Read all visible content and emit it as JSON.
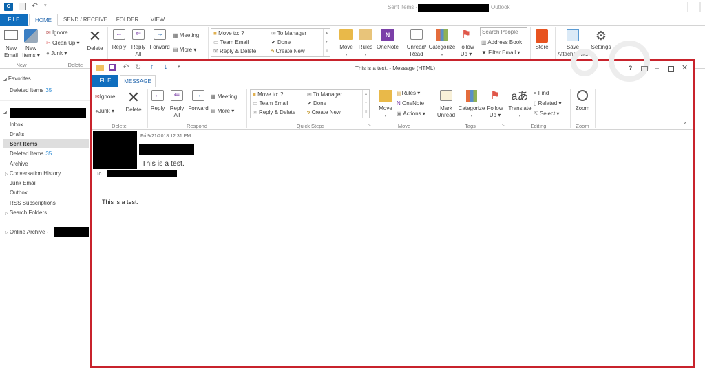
{
  "app": {
    "title_prefix": "Sent Items -",
    "title_suffix": "Outlook",
    "colors": {
      "accent": "#106ebe",
      "highlight_border": "#c8232c",
      "count": "#2a8ad4"
    }
  },
  "main_tabs": [
    {
      "label": "FILE"
    },
    {
      "label": "HOME"
    },
    {
      "label": "SEND / RECEIVE"
    },
    {
      "label": "FOLDER"
    },
    {
      "label": "VIEW"
    }
  ],
  "home_ribbon": {
    "new_email": "New\nEmail",
    "new_email_l1": "New",
    "new_email_l2": "Email",
    "new_items_l1": "New",
    "new_items_l2": "Items ▾",
    "group_new": "New",
    "ignore": "Ignore",
    "clean_up": "Clean Up ▾",
    "junk": "Junk ▾",
    "delete": "Delete",
    "group_delete": "Delete",
    "reply": "Reply",
    "reply_all_l1": "Reply",
    "reply_all_l2": "All",
    "forward": "Forward",
    "meeting": "Meeting",
    "more": "More ▾",
    "qs_move_to": "Move to: ?",
    "qs_team_email": "Team Email",
    "qs_reply_delete": "Reply & Delete",
    "qs_to_manager": "To Manager",
    "qs_done": "Done",
    "qs_create_new": "Create New",
    "move": "Move",
    "rules": "Rules",
    "onenote": "OneNote",
    "unread_l1": "Unread/",
    "unread_l2": "Read",
    "categorize": "Categorize",
    "follow_l1": "Follow",
    "follow_l2": "Up ▾",
    "search_people_placeholder": "Search People",
    "address_book": "Address Book",
    "filter_email": "Filter Email ▾",
    "store": "Store",
    "save_l1": "Save",
    "save_l2": "Attachments",
    "settings": "Settings"
  },
  "sidebar": {
    "favorites_label": "Favorites",
    "favorites": [
      {
        "label": "Deleted Items",
        "count": "35"
      }
    ],
    "folders": [
      {
        "label": "Inbox",
        "count": ""
      },
      {
        "label": "Drafts",
        "count": ""
      },
      {
        "label": "Sent Items",
        "count": "",
        "selected": true
      },
      {
        "label": "Deleted Items",
        "count": "35"
      },
      {
        "label": "Archive",
        "count": ""
      },
      {
        "label": "Conversation History",
        "count": "",
        "expandable": true
      },
      {
        "label": "Junk Email",
        "count": ""
      },
      {
        "label": "Outbox",
        "count": ""
      },
      {
        "label": "RSS Subscriptions",
        "count": ""
      },
      {
        "label": "Search Folders",
        "count": "",
        "expandable": true
      }
    ],
    "online_archive": "Online Archive -"
  },
  "message_window": {
    "title": "This is a test. - Message (HTML)",
    "tabs": [
      {
        "label": "FILE"
      },
      {
        "label": "MESSAGE"
      }
    ],
    "ribbon": {
      "ignore": "Ignore",
      "junk": "Junk ▾",
      "delete": "Delete",
      "group_delete": "Delete",
      "reply": "Reply",
      "reply_all_l1": "Reply",
      "reply_all_l2": "All",
      "forward": "Forward",
      "meeting": "Meeting",
      "more": "More ▾",
      "group_respond": "Respond",
      "qs_move_to": "Move to: ?",
      "qs_team_email": "Team Email",
      "qs_reply_delete": "Reply & Delete",
      "qs_to_manager": "To Manager",
      "qs_done": "Done",
      "qs_create_new": "Create New",
      "group_quick_steps": "Quick Steps",
      "move": "Move",
      "rules": "Rules ▾",
      "onenote": "OneNote",
      "actions": "Actions ▾",
      "group_move": "Move",
      "mark_l1": "Mark",
      "mark_l2": "Unread",
      "categorize": "Categorize",
      "follow_l1": "Follow",
      "follow_l2": "Up ▾",
      "group_tags": "Tags",
      "translate": "Translate",
      "find": "Find",
      "related": "Related ▾",
      "select": "Select ▾",
      "group_editing": "Editing",
      "zoom": "Zoom",
      "group_zoom": "Zoom"
    },
    "header": {
      "date": "Fri 9/21/2018 12:31 PM",
      "subject": "This is a test.",
      "to_label": "To"
    },
    "body": "This is a test."
  }
}
